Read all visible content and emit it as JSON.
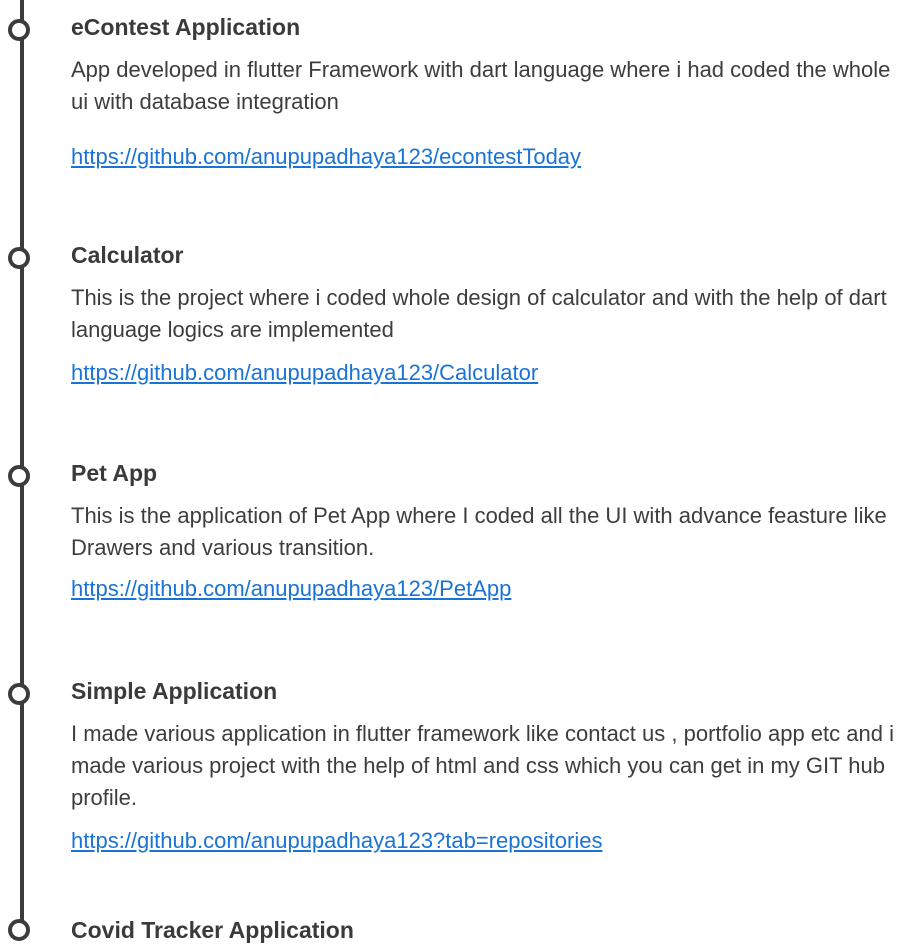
{
  "projects": [
    {
      "title": "eContest Application",
      "description": "App developed in flutter Framework with dart language  where i had coded the whole ui with database integration",
      "link": "https://github.com/anupupadhaya123/econtestToday"
    },
    {
      "title": "Calculator",
      "description": "This is the project where i coded whole design of calculator and with the help of dart language logics are implemented",
      "link": "https://github.com/anupupadhaya123/Calculator"
    },
    {
      "title": "Pet App",
      "description": "This is the application of Pet App where I coded all the UI with advance feasture like Drawers and various transition.",
      "link": "https://github.com/anupupadhaya123/PetApp"
    },
    {
      "title": "Simple Application",
      "description": "I made various application in flutter framework like contact us , portfolio app etc and i made various project with the help of html and css which you can get in my GIT hub profile.",
      "link": "https://github.com/anupupadhaya123?tab=repositories"
    },
    {
      "title": "Covid Tracker Application"
    }
  ]
}
